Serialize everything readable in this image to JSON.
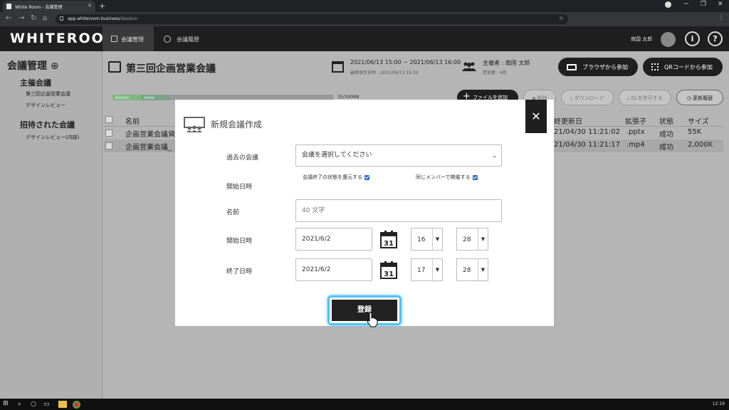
{
  "browser": {
    "tab_title": "White Room - 会議管理",
    "new_tab": "+",
    "tab_close": "✕",
    "url_host": "app.whiteroom.business",
    "url_path": "/Session",
    "minimize": "─",
    "maximize": "❐",
    "close": "✕"
  },
  "header": {
    "logo": "WHITEROOM",
    "nav": [
      "会議管理",
      "会議履歴"
    ],
    "user_name": "南国 太郎",
    "info_icon": "i",
    "help_icon": "?"
  },
  "sidebar": {
    "title": "会議管理",
    "add_icon": "⊕",
    "hosted_heading": "主催会議",
    "hosted_items": [
      "第三回企画営業会議",
      "デザインレビュー"
    ],
    "invited_heading": "招待された会議",
    "invited_items": [
      "デザインレビュー(内部)"
    ]
  },
  "page": {
    "title": "第三回企画営業会議",
    "date_range": "2021/06/13 15:00 ~ 2021/06/13 16:00",
    "last_saved": "最終保存日時 : 2021/06/13 15:30",
    "host": "主催者 : 南国 太郎",
    "participants": "参加者 : 4名",
    "join_browser": "ブラウザから参加",
    "join_qr": "QRコードから参加"
  },
  "toolbar": {
    "progress_material": "MATERIAL",
    "progress_avatar": "AVATAR",
    "storage": "35/300MB",
    "add_file": "ファイルを追加",
    "delete": "削除",
    "download": "ダウンロード",
    "allow_dl": "DLを許可する",
    "update_history": "更新履歴"
  },
  "table": {
    "headers": {
      "name": "名前",
      "updated": "終更新日",
      "ext": "拡張子",
      "status": "状態",
      "size": "サイズ"
    },
    "rows": [
      {
        "name": "企画営業会議資",
        "updated": "21/04/30 11:21:02",
        "ext": ".pptx",
        "status": "成功",
        "size": "55K"
      },
      {
        "name": "企画営業会議_",
        "updated": "21/04/30 11:21:17",
        "ext": ".mp4",
        "status": "成功",
        "size": "2,000K"
      }
    ]
  },
  "modal": {
    "title": "新規会議作成",
    "close": "✕",
    "past_label": "過去の会議",
    "past_select": "会議を選択してください",
    "restore_label": "会議終了の状態を還元する",
    "same_members_label": "同じメンバーで開催する",
    "start_label_1": "開始日時",
    "name_label": "名前",
    "name_placeholder": "40 文字",
    "start_label": "開始日時",
    "start_date": "2021/6/2",
    "start_hour": "16",
    "start_min": "28",
    "end_label": "終了日時",
    "end_date": "2021/6/2",
    "end_hour": "17",
    "end_min": "28",
    "calendar_day": "31",
    "register": "登録"
  },
  "taskbar": {
    "clock": "12:19"
  }
}
